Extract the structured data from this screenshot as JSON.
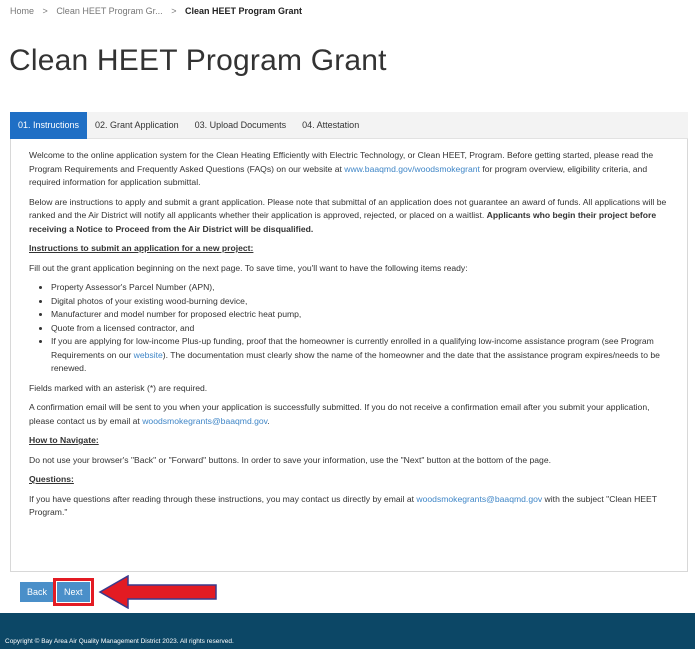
{
  "breadcrumb": {
    "home": "Home",
    "parent": "Clean HEET Program Gr...",
    "current": "Clean HEET Program Grant"
  },
  "page_title": "Clean HEET Program Grant",
  "tabs": [
    {
      "label": "01. Instructions",
      "active": true
    },
    {
      "label": "02. Grant Application",
      "active": false
    },
    {
      "label": "03. Upload Documents",
      "active": false
    },
    {
      "label": "04. Attestation",
      "active": false
    }
  ],
  "content": {
    "intro_1": "Welcome to the online application system for the Clean Heating Efficiently with Electric Technology, or Clean HEET, Program. Before getting started, please read the Program Requirements and Frequently Asked Questions (FAQs) on our website at ",
    "intro_link": "www.baaqmd.gov/woodsmokegrant",
    "intro_2": " for program overview, eligibility criteria, and required information for application submittal.",
    "para2_1": "Below are instructions to apply and submit a grant application. Please note that submittal of an application does not guarantee an award of funds. All applications will be ranked and the Air District will notify all applicants whether their application is approved, rejected, or placed on a waitlist. ",
    "para2_bold": "Applicants who begin their project before receiving a Notice to Proceed from the Air District will be disqualified.",
    "section1": "Instructions to submit an application for a new project:",
    "fill_out": "Fill out the grant application beginning on the next page. To save time, you'll want to have the following items ready:",
    "list": [
      "Property Assessor's Parcel Number (APN),",
      "Digital photos of your existing wood-burning device,",
      "Manufacturer and model number for proposed electric heat pump,",
      "Quote from a licensed contractor, and"
    ],
    "list_last_1": "If you are applying for low-income Plus-up funding, proof that the homeowner is currently enrolled in a qualifying low-income assistance program (see Program Requirements on our ",
    "list_last_link": "website",
    "list_last_2": "). The documentation must clearly show the name of the homeowner and the date that the assistance program expires/needs to be renewed.",
    "required_note": "Fields marked with an asterisk (*) are required.",
    "confirm_1": "A confirmation email will be sent to you when your application is successfully submitted. If you do not receive a confirmation email after you submit your application, please contact us by email at ",
    "confirm_link": "woodsmokegrants@baaqmd.gov",
    "confirm_2": ".",
    "section2": "How to Navigate:",
    "navigate": "Do not use your browser's \"Back\" or \"Forward\" buttons. In order to save your information, use the \"Next\" button at the bottom of the page.",
    "section3": "Questions:",
    "questions_1": "If you have questions after reading through these instructions, you may contact us directly by email at ",
    "questions_link": "woodsmokegrants@baaqmd.gov",
    "questions_2": " with the subject \"Clean HEET Program.\""
  },
  "buttons": {
    "back": "Back",
    "next": "Next"
  },
  "footer": "Copyright © Bay Area Air Quality Management District 2023. All rights reserved.",
  "colors": {
    "active_tab": "#1f6fc5",
    "button": "#4a8fc9",
    "highlight": "#e31b23",
    "footer": "#0c4766",
    "link": "#3f86c7"
  }
}
